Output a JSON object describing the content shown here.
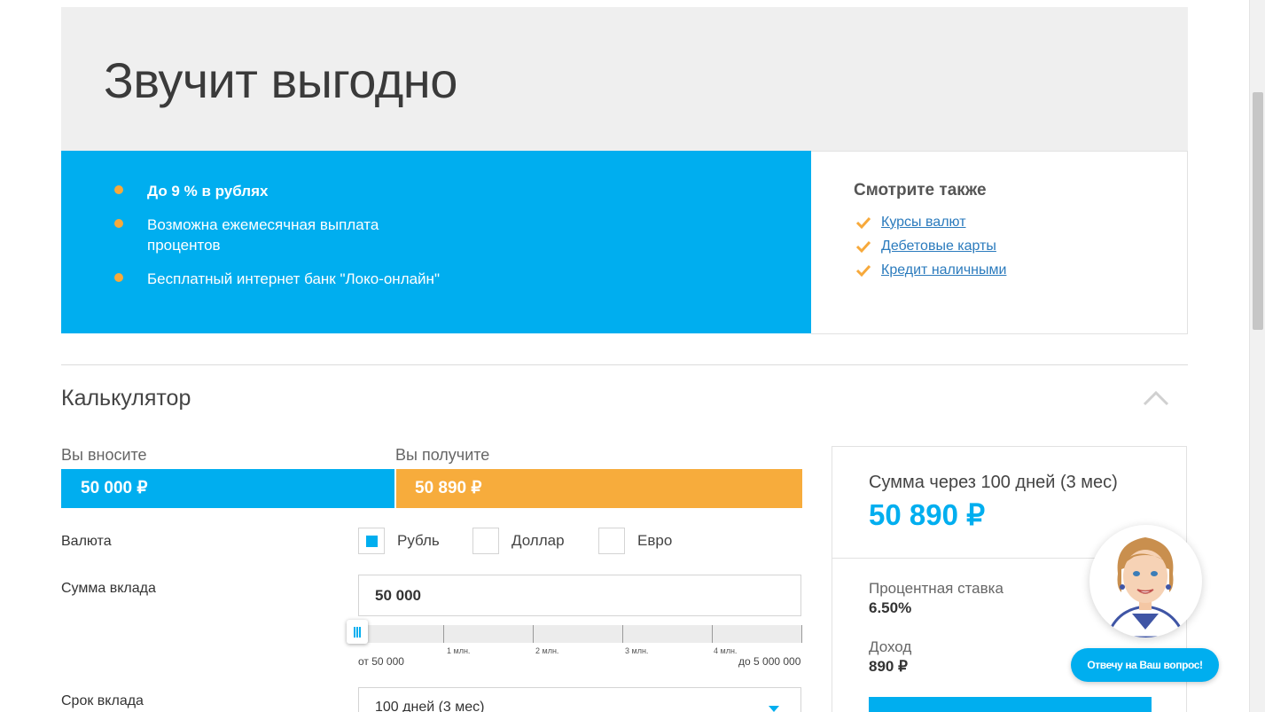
{
  "hero": {
    "title": "Звучит выгодно"
  },
  "features": [
    {
      "text": "До 9 % в рублях",
      "bold": true
    },
    {
      "text": "Возможна ежемесячная выплата процентов",
      "bold": false
    },
    {
      "text": "Бесплатный интернет банк \"Локо-онлайн\"",
      "bold": false
    }
  ],
  "see_also": {
    "title": "Смотрите также",
    "links": [
      "Курсы валют",
      "Дебетовые карты",
      "Кредит наличными"
    ]
  },
  "calculator": {
    "title": "Калькулятор",
    "you_deposit_label": "Вы вносите",
    "you_receive_label": "Вы получите",
    "deposit_value": "50 000 ₽",
    "receive_value": "50 890 ₽",
    "currency_label": "Валюта",
    "currencies": [
      {
        "label": "Рубль",
        "checked": true
      },
      {
        "label": "Доллар",
        "checked": false
      },
      {
        "label": "Евро",
        "checked": false
      }
    ],
    "amount_label": "Сумма вклада",
    "amount_value": "50 000",
    "slider": {
      "ticks": [
        "1 млн.",
        "2 млн.",
        "3 млн.",
        "4 млн."
      ],
      "min_label": "от 50 000",
      "max_label": "до 5 000 000",
      "min": 50000,
      "max": 5000000,
      "value": 50000
    },
    "term_label": "Срок вклада",
    "term_value": "100 дней (3 мес)"
  },
  "result": {
    "title": "Сумма через 100 дней (3 мес)",
    "value": "50 890 ₽",
    "rate_label": "Процентная ставка",
    "rate_value": "6.50%",
    "income_label": "Доход",
    "income_value": "890 ₽"
  },
  "assistant": {
    "bubble_text": "Отвечу на Ваш вопрос!"
  },
  "colors": {
    "accent": "#00aeef",
    "orange": "#f7ac3c",
    "link": "#2b7bbd"
  }
}
